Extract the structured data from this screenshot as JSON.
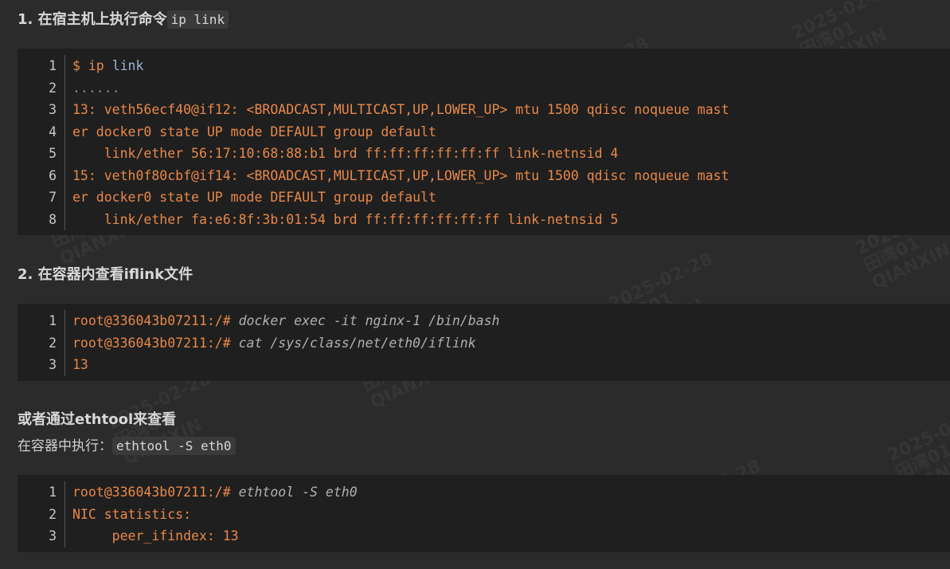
{
  "sections": [
    {
      "heading": "1. 在宿主机上执行命令",
      "inline_code": "ip link"
    },
    {
      "heading": "2. 在容器内查看iflink文件"
    },
    {
      "heading": "或者通过ethtool来查看",
      "para": "在容器中执行：",
      "inline_code": "ethtool -S eth0"
    }
  ],
  "block1": {
    "line_numbers": [
      "1",
      "2",
      "3",
      "4",
      "5",
      "6",
      "7",
      "8"
    ],
    "line1": {
      "dollar": "$",
      "ip": "ip",
      "link": "link"
    },
    "line2": "......",
    "line3": "13: veth56ecf40@if12: <BROADCAST,MULTICAST,UP,LOWER_UP> mtu 1500 qdisc noqueue mast",
    "line4": "er docker0 state UP mode DEFAULT group default",
    "line5": "    link/ether 56:17:10:68:88:b1 brd ff:ff:ff:ff:ff:ff link-netnsid 4",
    "line6": "15: veth0f80cbf@if14: <BROADCAST,MULTICAST,UP,LOWER_UP> mtu 1500 qdisc noqueue mast",
    "line7": "er docker0 state UP mode DEFAULT group default",
    "line8": "    link/ether fa:e6:8f:3b:01:54 brd ff:ff:ff:ff:ff:ff link-netnsid 5"
  },
  "block2": {
    "line_numbers": [
      "1",
      "2",
      "3"
    ],
    "line1": {
      "prompt": "root@336043b07211:/#",
      "cmd": " docker exec -it nginx-1 /bin/bash"
    },
    "line2": {
      "prompt": "root@336043b07211:/#",
      "cmd": " cat /sys/class/net/eth0/iflink"
    },
    "line3": "13"
  },
  "block3": {
    "line_numbers": [
      "1",
      "2",
      "3"
    ],
    "line1": {
      "prompt": "root@336043b07211:/#",
      "cmd": " ethtool -S eth0"
    },
    "line2": "NIC statistics:",
    "line3": "     peer_ifindex: 13"
  },
  "watermark": {
    "date": "2025-02-28",
    "name": "田湾01",
    "code": "QIANXIN"
  },
  "colors": {
    "background": "#2b2b2b",
    "code_bg": "#1f1f1f",
    "code_text": "#e8884a",
    "command_italic": "#b0b0b0",
    "keyword_blue": "#9cb4d8"
  }
}
